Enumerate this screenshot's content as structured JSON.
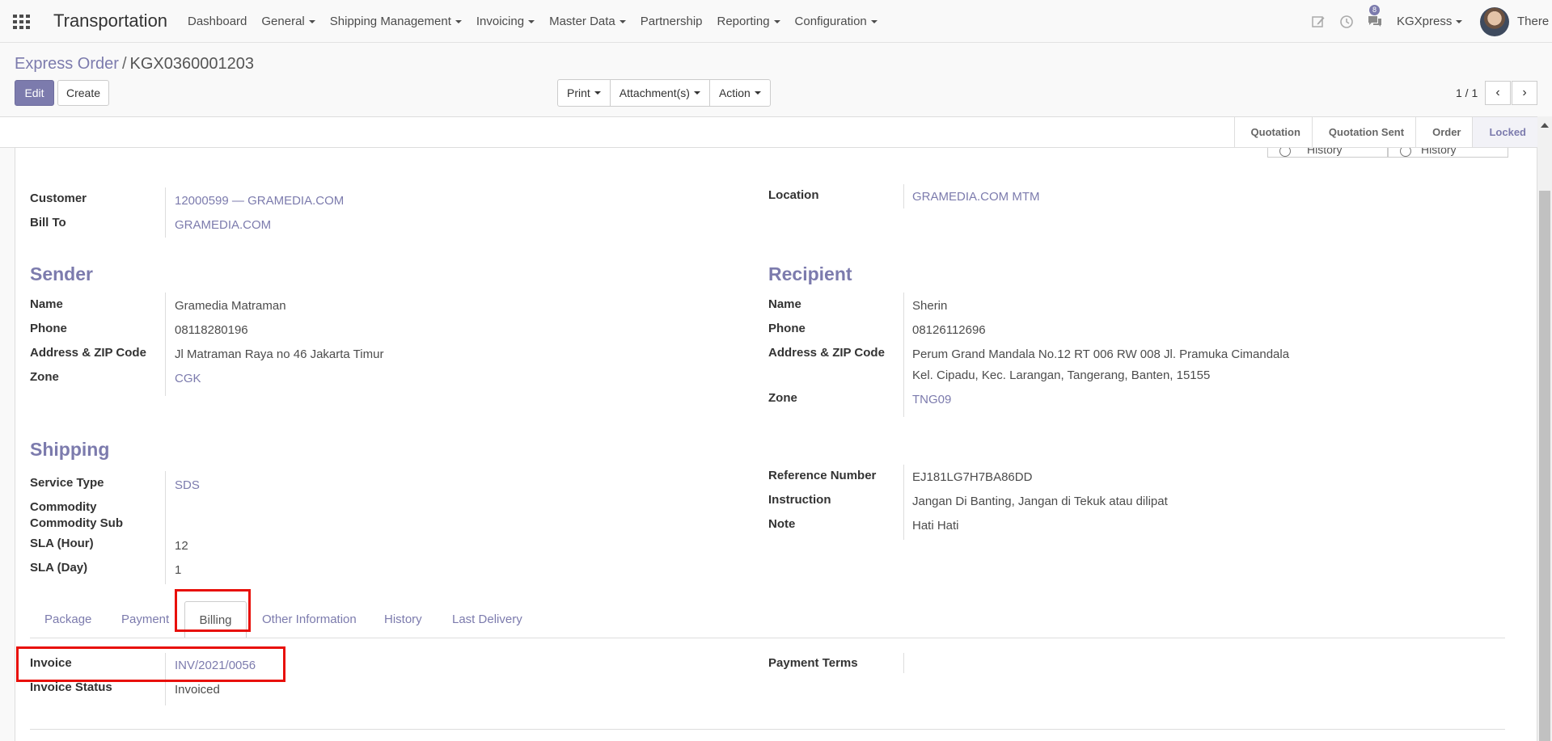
{
  "navbar": {
    "brand": "Transportation",
    "menu": [
      "Dashboard",
      "General",
      "Shipping Management",
      "Invoicing",
      "Master Data",
      "Partnership",
      "Reporting",
      "Configuration"
    ],
    "menu_has_caret": [
      false,
      true,
      true,
      true,
      true,
      false,
      true,
      true
    ],
    "messages_count": "8",
    "company": "KGXpress",
    "user": "There"
  },
  "breadcrumb": {
    "parent": "Express Order",
    "separator": "/",
    "current": "KGX0360001203"
  },
  "buttons": {
    "edit": "Edit",
    "create": "Create",
    "print": "Print",
    "attachments": "Attachment(s)",
    "action": "Action"
  },
  "pager": {
    "value": "1 / 1",
    "prev": "‹",
    "next": "›"
  },
  "status_stages": [
    "Quotation",
    "Quotation Sent",
    "Order",
    "Locked"
  ],
  "active_stage": "Locked",
  "smart_buttons": [
    "History",
    "History"
  ],
  "customer": {
    "customer_label": "Customer",
    "customer_value": "12000599 — GRAMEDIA.COM",
    "bill_to_label": "Bill To",
    "bill_to_value": "GRAMEDIA.COM",
    "location_label": "Location",
    "location_value": "GRAMEDIA.COM MTM"
  },
  "sender": {
    "title": "Sender",
    "name_label": "Name",
    "name": "Gramedia Matraman",
    "phone_label": "Phone",
    "phone": "08118280196",
    "address_label": "Address & ZIP Code",
    "address": "Jl Matraman Raya no 46 Jakarta Timur",
    "zone_label": "Zone",
    "zone": "CGK"
  },
  "recipient": {
    "title": "Recipient",
    "name_label": "Name",
    "name": "Sherin",
    "phone_label": "Phone",
    "phone": "08126112696",
    "address_label": "Address & ZIP Code",
    "address_line1": "Perum Grand Mandala No.12 RT 006 RW 008 Jl. Pramuka Cimandala",
    "address_line2": "Kel. Cipadu, Kec. Larangan, Tangerang, Banten, 15155",
    "zone_label": "Zone",
    "zone": "TNG09"
  },
  "shipping": {
    "title": "Shipping",
    "service_type_label": "Service Type",
    "service_type": "SDS",
    "commodity_label": "Commodity",
    "commodity_sub_label": "Commodity Sub",
    "sla_hour_label": "SLA (Hour)",
    "sla_hour": "12",
    "sla_day_label": "SLA (Day)",
    "sla_day": "1",
    "reference_label": "Reference Number",
    "reference": "EJ181LG7H7BA86DD",
    "instruction_label": "Instruction",
    "instruction": "Jangan Di Banting, Jangan di Tekuk atau dilipat",
    "note_label": "Note",
    "note": "Hati Hati"
  },
  "tabs": [
    "Package",
    "Payment",
    "Billing",
    "Other Information",
    "History",
    "Last Delivery"
  ],
  "active_tab": "Billing",
  "billing": {
    "invoice_label": "Invoice",
    "invoice": "INV/2021/0056",
    "invoice_status_label": "Invoice Status",
    "invoice_status": "Invoiced",
    "payment_terms_label": "Payment Terms",
    "payment_terms": ""
  },
  "colors": {
    "accent": "#7c7bad",
    "highlight": "#e8100a"
  }
}
